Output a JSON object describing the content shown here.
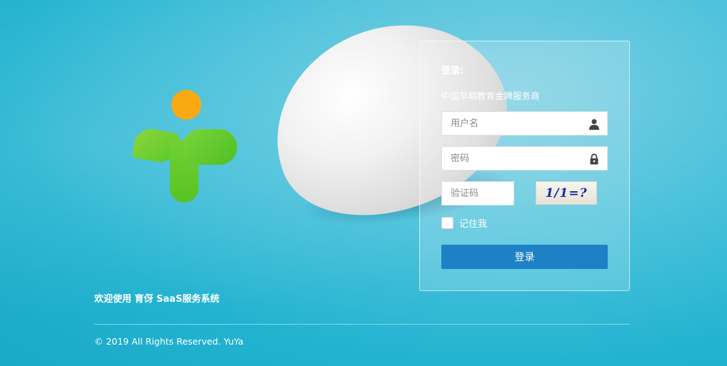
{
  "login": {
    "title": "登录:",
    "subtitle": "中国早期教育金牌服务商",
    "username_placeholder": "用户名",
    "password_placeholder": "密码",
    "captcha_placeholder": "验证码",
    "captcha_text": "1/1=?",
    "remember_label": "记住我",
    "submit_label": "登录"
  },
  "welcome_text": "欢迎使用 育伢 SaaS服务系统",
  "copyright": "© 2019 All Rights Reserved. YuYa",
  "icons": [
    "logo-icon",
    "user-icon",
    "lock-icon"
  ],
  "colors": {
    "accent": "#1e81c6",
    "logo_orange": "#f9a912",
    "logo_green": "#5cc82a",
    "background": "#22b3d0"
  }
}
